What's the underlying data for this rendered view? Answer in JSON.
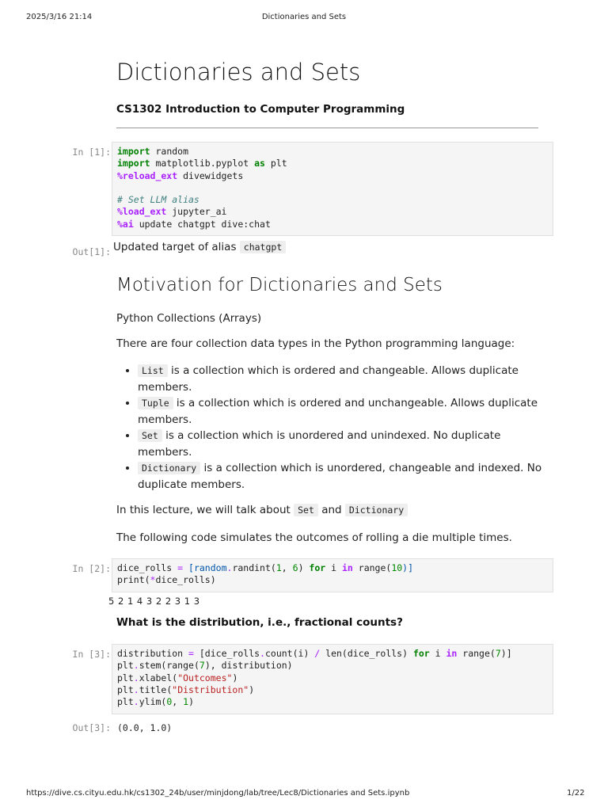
{
  "header": {
    "datetime": "2025/3/16 21:14",
    "title": "Dictionaries and Sets"
  },
  "footer": {
    "url": "https://dive.cs.cityu.edu.hk/cs1302_24b/user/minjdong/lab/tree/Lec8/Dictionaries and Sets.ipynb",
    "page": "1/22"
  },
  "doc": {
    "title": "Dictionaries and Sets",
    "subtitle": "CS1302 Introduction to Computer Programming"
  },
  "cells": [
    {
      "prompt": "In [1]:",
      "lines": [
        [
          [
            "import",
            "kw"
          ],
          [
            " random",
            "tx"
          ]
        ],
        [
          [
            "import",
            "kw"
          ],
          [
            " matplotlib.pyplot ",
            "tx"
          ],
          [
            "as",
            "kw"
          ],
          [
            " plt",
            "tx"
          ]
        ],
        [
          [
            "%reload_ext",
            "mg"
          ],
          [
            " divewidgets",
            "tx"
          ]
        ],
        [
          [
            " ",
            "tx"
          ]
        ],
        [
          [
            "# Set LLM alias",
            "cm"
          ]
        ],
        [
          [
            "%load_ext",
            "mg"
          ],
          [
            " jupyter_ai",
            "tx"
          ]
        ],
        [
          [
            "%ai",
            "mg"
          ],
          [
            " update chatgpt dive:chat",
            "tx"
          ]
        ]
      ]
    },
    {
      "prompt": "In [2]:",
      "lines": [
        [
          [
            "dice_rolls ",
            "tx"
          ],
          [
            "=",
            "op"
          ],
          [
            " [random",
            "pn"
          ],
          [
            ".",
            "op"
          ],
          [
            "randint(",
            "tx"
          ],
          [
            "1",
            "num"
          ],
          [
            ", ",
            "tx"
          ],
          [
            "6",
            "num"
          ],
          [
            ") ",
            "tx"
          ],
          [
            "for",
            "kw"
          ],
          [
            " i ",
            "tx"
          ],
          [
            "in",
            "mg"
          ],
          [
            " range(",
            "tx"
          ],
          [
            "10",
            "num"
          ],
          [
            ")]",
            "pn"
          ]
        ],
        [
          [
            "print(",
            "tx"
          ],
          [
            "*",
            "op"
          ],
          [
            "dice_rolls)",
            "tx"
          ]
        ]
      ]
    },
    {
      "prompt": "In [3]:",
      "lines": [
        [
          [
            "distribution ",
            "tx"
          ],
          [
            "=",
            "op"
          ],
          [
            " [dice_rolls",
            "tx"
          ],
          [
            ".",
            "op"
          ],
          [
            "count(i) ",
            "tx"
          ],
          [
            "/",
            "op"
          ],
          [
            " len(dice_rolls) ",
            "tx"
          ],
          [
            "for",
            "kw"
          ],
          [
            " i ",
            "tx"
          ],
          [
            "in",
            "mg"
          ],
          [
            " range(",
            "tx"
          ],
          [
            "7",
            "num"
          ],
          [
            ")]",
            "tx"
          ]
        ],
        [
          [
            "plt",
            "tx"
          ],
          [
            ".",
            "op"
          ],
          [
            "stem(range(",
            "tx"
          ],
          [
            "7",
            "num"
          ],
          [
            "), distribution)",
            "tx"
          ]
        ],
        [
          [
            "plt",
            "tx"
          ],
          [
            ".",
            "op"
          ],
          [
            "xlabel(",
            "tx"
          ],
          [
            "\"Outcomes\"",
            "str"
          ],
          [
            ")",
            "tx"
          ]
        ],
        [
          [
            "plt",
            "tx"
          ],
          [
            ".",
            "op"
          ],
          [
            "title(",
            "tx"
          ],
          [
            "\"Distribution\"",
            "str"
          ],
          [
            ")",
            "tx"
          ]
        ],
        [
          [
            "plt",
            "tx"
          ],
          [
            ".",
            "op"
          ],
          [
            "ylim(",
            "tx"
          ],
          [
            "0",
            "num"
          ],
          [
            ", ",
            "tx"
          ],
          [
            "1",
            "num"
          ],
          [
            ")",
            "tx"
          ]
        ]
      ]
    }
  ],
  "out1": {
    "prompt": "Out[1]:",
    "text": "Updated target of alias",
    "code": "chatgpt"
  },
  "section": {
    "heading": "Motivation for Dictionaries and Sets",
    "p1": "Python Collections (Arrays)",
    "p2": "There are four collection data types in the Python programming language:",
    "bullets": [
      {
        "code": "List",
        "text": "is a collection which is ordered and changeable. Allows duplicate members."
      },
      {
        "code": "Tuple",
        "text": "is a collection which is ordered and unchangeable. Allows duplicate members."
      },
      {
        "code": "Set",
        "text": "is a collection which is unordered and unindexed. No duplicate members."
      },
      {
        "code": "Dictionary",
        "text": "is a collection which is unordered, changeable and indexed. No duplicate members."
      }
    ],
    "p3a": "In this lecture, we will talk about",
    "p3code1": "Set",
    "p3and": "and",
    "p3code2": "Dictionary",
    "p4": "The following code simulates the outcomes of rolling a die multiple times."
  },
  "out2": {
    "text": "5 2 1 4 3 2 2 3 1 3"
  },
  "question": "What is the distribution, i.e., fractional counts?",
  "out3": {
    "prompt": "Out[3]:",
    "text": "(0.0, 1.0)"
  }
}
